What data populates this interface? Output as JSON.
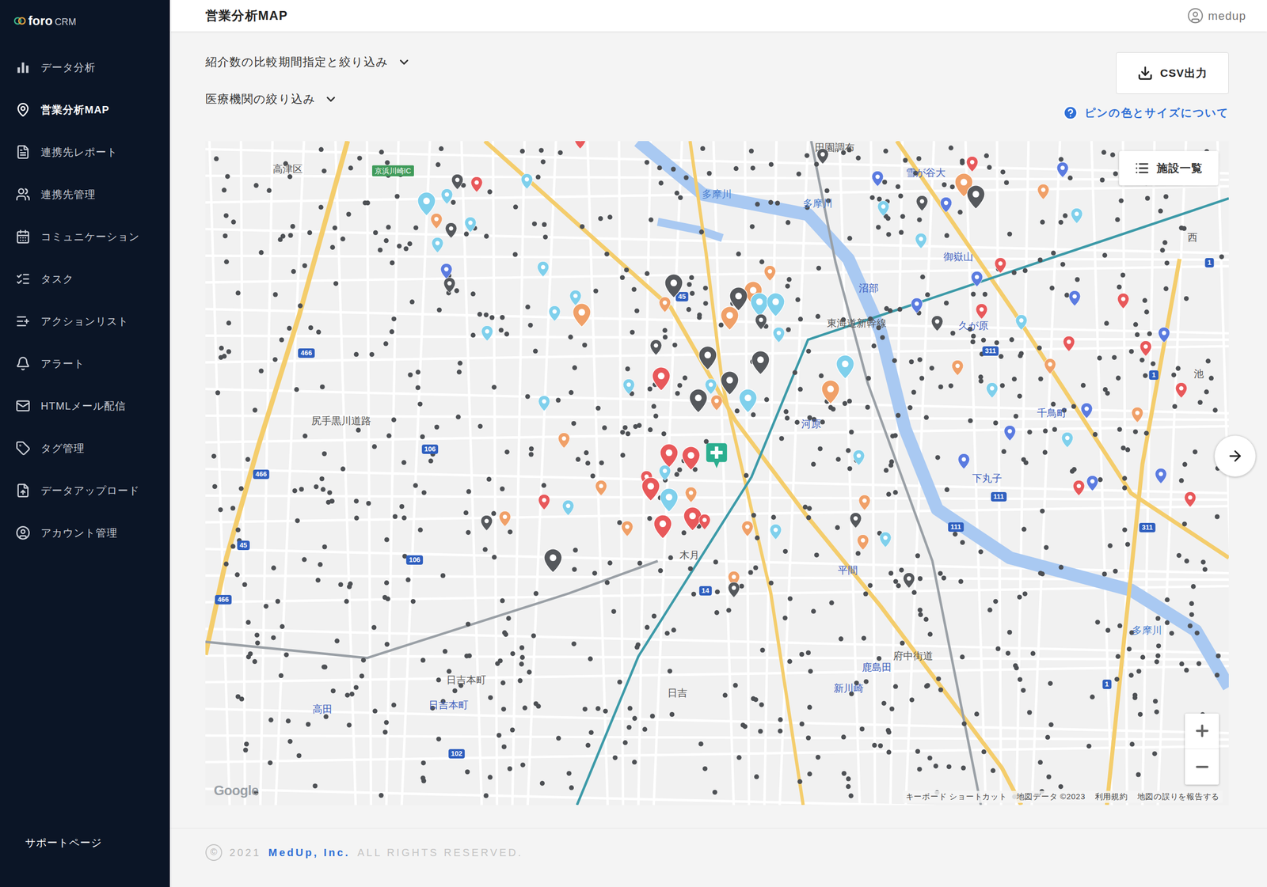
{
  "header": {
    "title": "営業分析MAP",
    "user": "medup"
  },
  "logo": {
    "name": "foro",
    "suffix": "CRM"
  },
  "sidebar": {
    "items": [
      {
        "label": "データ分析",
        "selected": false
      },
      {
        "label": "営業分析MAP",
        "selected": true
      },
      {
        "label": "連携先レポート",
        "selected": false
      },
      {
        "label": "連携先管理",
        "selected": false
      },
      {
        "label": "コミュニケーション",
        "selected": false
      },
      {
        "label": "タスク",
        "selected": false
      },
      {
        "label": "アクションリスト",
        "selected": false
      },
      {
        "label": "アラート",
        "selected": false
      },
      {
        "label": "HTMLメール配信",
        "selected": false
      },
      {
        "label": "タグ管理",
        "selected": false
      },
      {
        "label": "データアップロード",
        "selected": false
      },
      {
        "label": "アカウント管理",
        "selected": false
      }
    ],
    "support": "サポートページ"
  },
  "filters": [
    {
      "label": "紹介数の比較期間指定と絞り込み",
      "expanded": false
    },
    {
      "label": "医療機関の絞り込み",
      "expanded": false
    }
  ],
  "csv_button": "CSV出力",
  "help_link": "ピンの色とサイズについて",
  "map": {
    "facility_list_button": "施設一覧",
    "google": "Google",
    "attribution": [
      "キーボード ショートカット",
      "地図データ ©2023",
      "利用規約",
      "地図の誤りを報告する"
    ],
    "dot_color": "#4d5054",
    "home": {
      "color": "#2bae8f"
    },
    "labels": [
      {
        "text": "高津区",
        "kind": "place"
      },
      {
        "text": "京浜川崎IC",
        "kind": "badge"
      },
      {
        "text": "多摩川",
        "kind": "water"
      },
      {
        "text": "多摩川",
        "kind": "water"
      },
      {
        "text": "田園調布",
        "kind": "place"
      },
      {
        "text": "雪が谷大",
        "kind": "station"
      },
      {
        "text": "御嶽山",
        "kind": "station"
      },
      {
        "text": "沼部",
        "kind": "station"
      },
      {
        "text": "東海道新幹線",
        "kind": "place"
      },
      {
        "text": "久が原",
        "kind": "station"
      },
      {
        "text": "千鳥町",
        "kind": "station"
      },
      {
        "text": "下丸子",
        "kind": "station"
      },
      {
        "text": "河原",
        "kind": "station"
      },
      {
        "text": "平間",
        "kind": "station"
      },
      {
        "text": "木月",
        "kind": "place"
      },
      {
        "text": "日吉本町",
        "kind": "place"
      },
      {
        "text": "日吉本町",
        "kind": "station"
      },
      {
        "text": "高田",
        "kind": "station"
      },
      {
        "text": "日吉",
        "kind": "place"
      },
      {
        "text": "鹿島田",
        "kind": "station"
      },
      {
        "text": "新川崎",
        "kind": "station"
      },
      {
        "text": "西",
        "kind": "place"
      },
      {
        "text": "池",
        "kind": "place"
      },
      {
        "text": "多摩川",
        "kind": "water"
      },
      {
        "text": "尻手黒川道路",
        "kind": "place"
      },
      {
        "text": "府中街道",
        "kind": "place"
      }
    ],
    "shields": [
      "466",
      "466",
      "45",
      "466",
      "106",
      "106",
      "14",
      "102",
      "311",
      "1",
      "111",
      "111",
      "311",
      "1",
      "1",
      "45"
    ],
    "pins": [
      {
        "color": "#e8585a",
        "kind": "small"
      },
      {
        "color": "#e8585a",
        "kind": "small"
      },
      {
        "color": "#e8585a",
        "kind": "large"
      },
      {
        "color": "#e8585a",
        "kind": "large"
      },
      {
        "color": "#e8585a",
        "kind": "large"
      },
      {
        "color": "#e8585a",
        "kind": "small"
      },
      {
        "color": "#e8585a",
        "kind": "large"
      },
      {
        "color": "#e8585a",
        "kind": "large"
      },
      {
        "color": "#e8585a",
        "kind": "large"
      },
      {
        "color": "#e8585a",
        "kind": "small"
      },
      {
        "color": "#e8585a",
        "kind": "small"
      },
      {
        "color": "#e8585a",
        "kind": "small"
      },
      {
        "color": "#e8585a",
        "kind": "small"
      },
      {
        "color": "#e8585a",
        "kind": "small"
      },
      {
        "color": "#e8585a",
        "kind": "small"
      },
      {
        "color": "#e8585a",
        "kind": "small"
      },
      {
        "color": "#e8585a",
        "kind": "small"
      },
      {
        "color": "#e8585a",
        "kind": "small"
      },
      {
        "color": "#e8585a",
        "kind": "small"
      },
      {
        "color": "#e8585a",
        "kind": "small"
      },
      {
        "color": "#f0a068",
        "kind": "large"
      },
      {
        "color": "#f0a068",
        "kind": "small"
      },
      {
        "color": "#f0a068",
        "kind": "large"
      },
      {
        "color": "#f0a068",
        "kind": "large"
      },
      {
        "color": "#f0a068",
        "kind": "small"
      },
      {
        "color": "#f0a068",
        "kind": "small"
      },
      {
        "color": "#f0a068",
        "kind": "small"
      },
      {
        "color": "#f0a068",
        "kind": "small"
      },
      {
        "color": "#f0a068",
        "kind": "small"
      },
      {
        "color": "#f0a068",
        "kind": "small"
      },
      {
        "color": "#f0a068",
        "kind": "small"
      },
      {
        "color": "#f0a068",
        "kind": "large"
      },
      {
        "color": "#f0a068",
        "kind": "small"
      },
      {
        "color": "#f0a068",
        "kind": "small"
      },
      {
        "color": "#f0a068",
        "kind": "large"
      },
      {
        "color": "#f0a068",
        "kind": "small"
      },
      {
        "color": "#f0a068",
        "kind": "small"
      },
      {
        "color": "#f0a068",
        "kind": "small"
      },
      {
        "color": "#f0a068",
        "kind": "small"
      },
      {
        "color": "#f0a068",
        "kind": "small"
      },
      {
        "color": "#f0a068",
        "kind": "small"
      },
      {
        "color": "#f0a068",
        "kind": "small"
      },
      {
        "color": "#7fd0ec",
        "kind": "large"
      },
      {
        "color": "#7fd0ec",
        "kind": "small"
      },
      {
        "color": "#7fd0ec",
        "kind": "small"
      },
      {
        "color": "#7fd0ec",
        "kind": "small"
      },
      {
        "color": "#7fd0ec",
        "kind": "small"
      },
      {
        "color": "#7fd0ec",
        "kind": "small"
      },
      {
        "color": "#7fd0ec",
        "kind": "small"
      },
      {
        "color": "#7fd0ec",
        "kind": "small"
      },
      {
        "color": "#7fd0ec",
        "kind": "small"
      },
      {
        "color": "#7fd0ec",
        "kind": "large"
      },
      {
        "color": "#7fd0ec",
        "kind": "large"
      },
      {
        "color": "#7fd0ec",
        "kind": "small"
      },
      {
        "color": "#7fd0ec",
        "kind": "large"
      },
      {
        "color": "#7fd0ec",
        "kind": "small"
      },
      {
        "color": "#7fd0ec",
        "kind": "large"
      },
      {
        "color": "#7fd0ec",
        "kind": "small"
      },
      {
        "color": "#7fd0ec",
        "kind": "small"
      },
      {
        "color": "#7fd0ec",
        "kind": "large"
      },
      {
        "color": "#7fd0ec",
        "kind": "small"
      },
      {
        "color": "#7fd0ec",
        "kind": "small"
      },
      {
        "color": "#7fd0ec",
        "kind": "small"
      },
      {
        "color": "#7fd0ec",
        "kind": "small"
      },
      {
        "color": "#7fd0ec",
        "kind": "small"
      },
      {
        "color": "#7fd0ec",
        "kind": "small"
      },
      {
        "color": "#7fd0ec",
        "kind": "small"
      },
      {
        "color": "#7fd0ec",
        "kind": "small"
      },
      {
        "color": "#7fd0ec",
        "kind": "small"
      },
      {
        "color": "#7fd0ec",
        "kind": "small"
      },
      {
        "color": "#7fd0ec",
        "kind": "small"
      },
      {
        "color": "#55585c",
        "kind": "large"
      },
      {
        "color": "#55585c",
        "kind": "large"
      },
      {
        "color": "#55585c",
        "kind": "large"
      },
      {
        "color": "#55585c",
        "kind": "large"
      },
      {
        "color": "#55585c",
        "kind": "large"
      },
      {
        "color": "#55585c",
        "kind": "large"
      },
      {
        "color": "#55585c",
        "kind": "large"
      },
      {
        "color": "#55585c",
        "kind": "small"
      },
      {
        "color": "#55585c",
        "kind": "large"
      },
      {
        "color": "#55585c",
        "kind": "small"
      },
      {
        "color": "#55585c",
        "kind": "small"
      },
      {
        "color": "#55585c",
        "kind": "small"
      },
      {
        "color": "#55585c",
        "kind": "small"
      },
      {
        "color": "#55585c",
        "kind": "small"
      },
      {
        "color": "#55585c",
        "kind": "small"
      },
      {
        "color": "#55585c",
        "kind": "small"
      },
      {
        "color": "#55585c",
        "kind": "small"
      },
      {
        "color": "#55585c",
        "kind": "small"
      },
      {
        "color": "#55585c",
        "kind": "small"
      },
      {
        "color": "#55585c",
        "kind": "small"
      },
      {
        "color": "#5b7be0",
        "kind": "small"
      },
      {
        "color": "#5b7be0",
        "kind": "small"
      },
      {
        "color": "#5b7be0",
        "kind": "small"
      },
      {
        "color": "#5b7be0",
        "kind": "small"
      },
      {
        "color": "#5b7be0",
        "kind": "small"
      },
      {
        "color": "#5b7be0",
        "kind": "small"
      },
      {
        "color": "#5b7be0",
        "kind": "small"
      },
      {
        "color": "#5b7be0",
        "kind": "small"
      },
      {
        "color": "#5b7be0",
        "kind": "small"
      },
      {
        "color": "#5b7be0",
        "kind": "small"
      },
      {
        "color": "#5b7be0",
        "kind": "small"
      },
      {
        "color": "#5b7be0",
        "kind": "small"
      },
      {
        "color": "#5b7be0",
        "kind": "small"
      }
    ]
  },
  "footer": {
    "symbol": "©",
    "year": "2021",
    "company": "MedUp, Inc.",
    "rights": "ALL RIGHTS RESERVED."
  }
}
